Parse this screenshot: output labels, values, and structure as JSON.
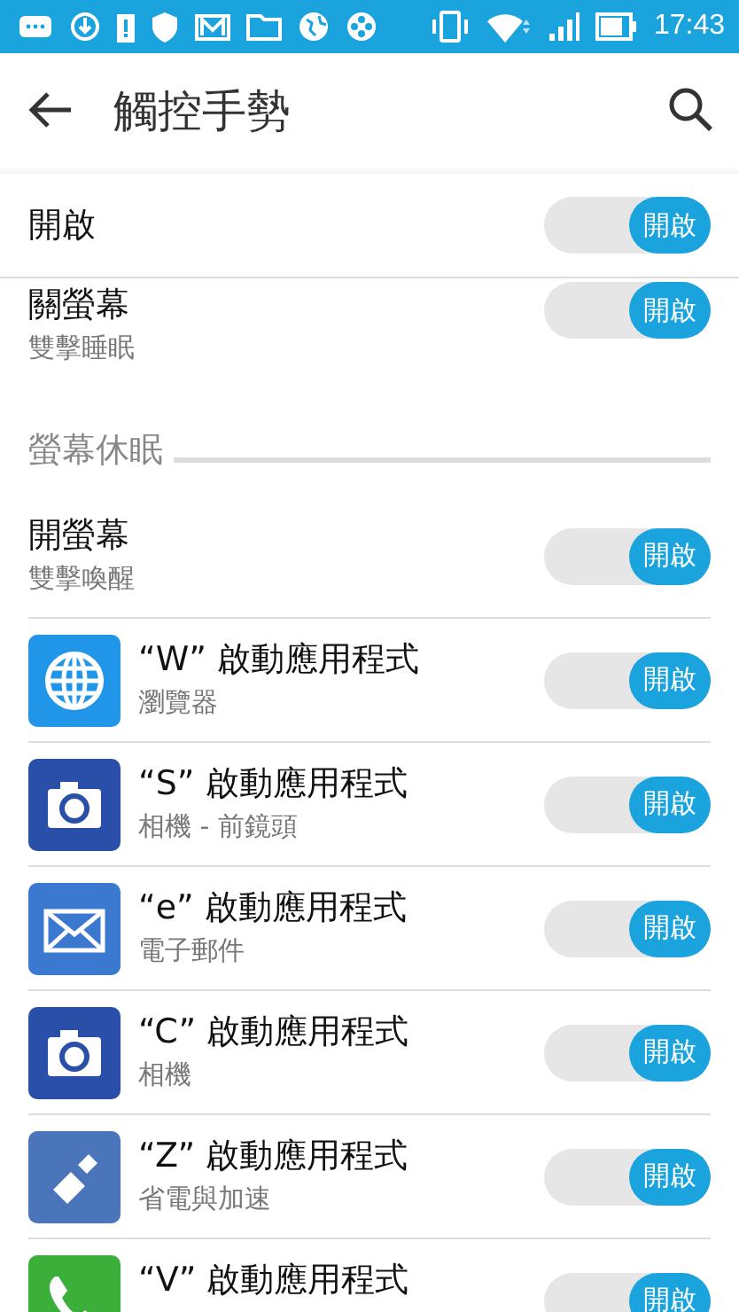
{
  "status_bar": {
    "time": "17:43"
  },
  "app_bar": {
    "title": "觸控手勢"
  },
  "master": {
    "title": "開啟",
    "on": true,
    "switch_label": "開啟"
  },
  "items": [
    {
      "kind": "toggle",
      "title": "關螢幕",
      "subtitle": "雙擊睡眠",
      "on": true,
      "switch_label": "開啟"
    },
    {
      "kind": "section",
      "title": "螢幕休眠"
    },
    {
      "kind": "toggle",
      "title": "開螢幕",
      "subtitle": "雙擊喚醒",
      "on": true,
      "switch_label": "開啟"
    },
    {
      "kind": "app",
      "title": "“W” 啟動應用程式",
      "subtitle": "瀏覽器",
      "on": true,
      "switch_label": "開啟"
    },
    {
      "kind": "app",
      "title": "“S” 啟動應用程式",
      "subtitle": "相機 - 前鏡頭",
      "on": true,
      "switch_label": "開啟"
    },
    {
      "kind": "app",
      "title": "“e” 啟動應用程式",
      "subtitle": "電子郵件",
      "on": true,
      "switch_label": "開啟"
    },
    {
      "kind": "app",
      "title": "“C” 啟動應用程式",
      "subtitle": "相機",
      "on": true,
      "switch_label": "開啟"
    },
    {
      "kind": "app",
      "title": "“Z” 啟動應用程式",
      "subtitle": "省電與加速",
      "on": true,
      "switch_label": "開啟"
    },
    {
      "kind": "app",
      "title": "“V” 啟動應用程式",
      "on": true,
      "switch_label": "開啟"
    }
  ]
}
